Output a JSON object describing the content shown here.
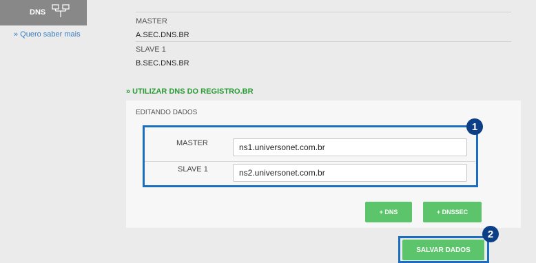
{
  "sidebar": {
    "tab_label": "DNS",
    "tab_icon": "network-icon",
    "link": "» Quero saber mais"
  },
  "current_dns": [
    {
      "label": "MASTER",
      "value": "A.SEC.DNS.BR"
    },
    {
      "label": "SLAVE 1",
      "value": "B.SEC.DNS.BR"
    }
  ],
  "registro_link": "» UTILIZAR DNS DO REGISTRO.BR",
  "edit": {
    "title": "EDITANDO DADOS",
    "rows": [
      {
        "label": "MASTER",
        "value": "ns1.universonet.com.br"
      },
      {
        "label": "SLAVE 1",
        "value": "ns2.universonet.com.br"
      }
    ],
    "add_dns_label": "+ DNS",
    "add_dnssec_label": "+ DNSSEC"
  },
  "save_label": "SALVAR DADOS",
  "annotations": [
    "1",
    "2"
  ],
  "colors": {
    "accent_green": "#5cc56b",
    "link_green": "#2a9a35",
    "highlight_blue": "#1a6ec0",
    "badge_navy": "#0d3f86",
    "link_blue": "#3a7ebf"
  }
}
